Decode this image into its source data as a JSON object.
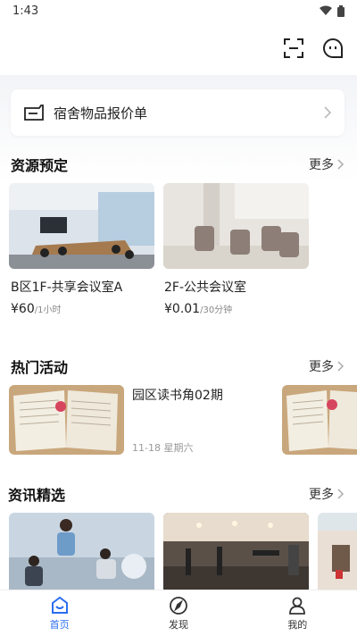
{
  "status": {
    "time": "1:43"
  },
  "quote_card": {
    "label": "宿舍物品报价单"
  },
  "resources": {
    "title": "资源预定",
    "more": "更多",
    "items": [
      {
        "title": "B区1F-共享会议室A",
        "price": "¥60",
        "unit": "/1小时"
      },
      {
        "title": "2F-公共会议室",
        "price": "¥0.01",
        "unit": "/30分钟"
      }
    ]
  },
  "events": {
    "title": "热门活动",
    "more": "更多",
    "items": [
      {
        "title": "园区读书角02期",
        "date": "11-18 星期六"
      }
    ]
  },
  "news": {
    "title": "资讯精选",
    "more": "更多"
  },
  "tabbar": {
    "tabs": [
      {
        "label": "首页",
        "icon": "home-icon"
      },
      {
        "label": "发现",
        "icon": "compass-icon"
      },
      {
        "label": "我的",
        "icon": "user-icon"
      }
    ]
  },
  "colors": {
    "accent": "#2a6ef0"
  }
}
